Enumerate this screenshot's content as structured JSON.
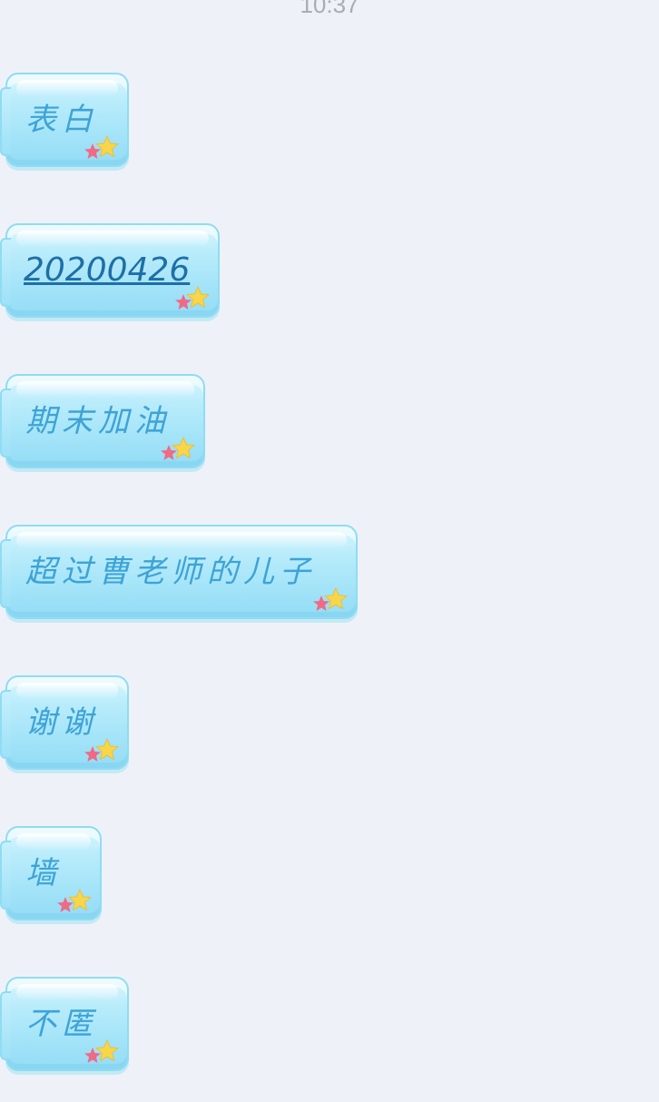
{
  "status": {
    "time": "10:37"
  },
  "messages": [
    {
      "text": "表白",
      "is_link": false
    },
    {
      "text": "20200426",
      "is_link": true
    },
    {
      "text": "期末加油",
      "is_link": false
    },
    {
      "text": "超过曹老师的儿子",
      "is_link": false
    },
    {
      "text": "谢谢",
      "is_link": false
    },
    {
      "text": "墙",
      "is_link": false
    },
    {
      "text": "不匿",
      "is_link": false
    }
  ],
  "bubble_decoration": "star-icon",
  "colors": {
    "background": "#eef2f8",
    "bubble": "#a2e3f8",
    "text": "#3da3d6",
    "link": "#1d6fa6"
  }
}
